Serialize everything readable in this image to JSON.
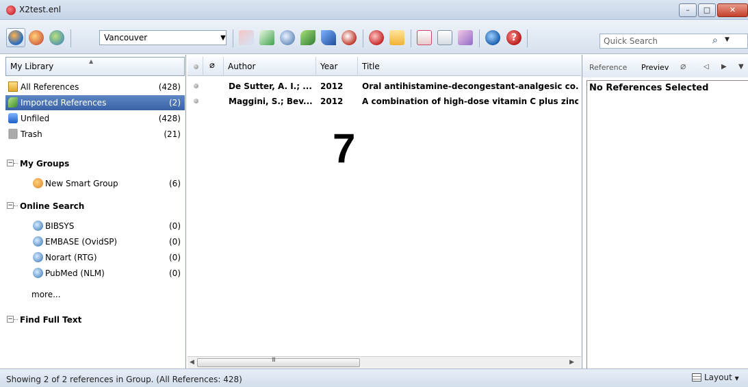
{
  "window": {
    "title": "X2test.enl",
    "min_glyph": "–",
    "max_glyph": "□",
    "close_glyph": "✕"
  },
  "toolbar": {
    "style_select_value": "Vancouver",
    "quick_search_placeholder": "Quick Search"
  },
  "library": {
    "header": "My Library",
    "items": [
      {
        "label": "All References",
        "count": "(428)",
        "icon": "all-references-icon"
      },
      {
        "label": "Imported References",
        "count": "(2)",
        "icon": "imported-references-icon",
        "selected": true
      },
      {
        "label": "Unfiled",
        "count": "(428)",
        "icon": "unfiled-icon"
      },
      {
        "label": "Trash",
        "count": "(21)",
        "icon": "trash-icon"
      }
    ],
    "groups": {
      "my_groups": {
        "label": "My Groups",
        "items": [
          {
            "label": "New Smart Group",
            "count": "(6)"
          }
        ]
      },
      "online_search": {
        "label": "Online Search",
        "items": [
          {
            "label": "BIBSYS",
            "count": "(0)"
          },
          {
            "label": "EMBASE (OvidSP)",
            "count": "(0)"
          },
          {
            "label": "Norart (RTG)",
            "count": "(0)"
          },
          {
            "label": "PubMed (NLM)",
            "count": "(0)"
          }
        ],
        "more": "more..."
      },
      "find_full_text": {
        "label": "Find Full Text"
      }
    }
  },
  "references": {
    "columns": {
      "author": "Author",
      "year": "Year",
      "title": "Title"
    },
    "rows": [
      {
        "author": "De Sutter, A. I.; ...",
        "year": "2012",
        "title": "Oral antihistamine-decongestant-analgesic co..."
      },
      {
        "author": "Maggini, S.; Bev...",
        "year": "2012",
        "title": "A combination of high-dose vitamin C plus zinc..."
      }
    ],
    "overlay_number": "7",
    "scroll_grip": "III"
  },
  "preview": {
    "tab_reference": "Reference",
    "tab_preview": "Previev",
    "message": "No References Selected"
  },
  "status": {
    "text": "Showing 2 of 2 references in Group. (All References: 428)",
    "layout_label": "Layout"
  }
}
